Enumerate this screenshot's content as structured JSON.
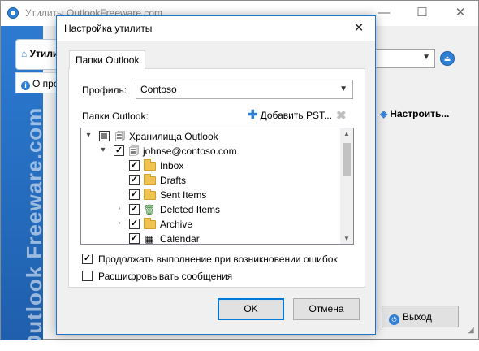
{
  "main_window": {
    "title": "Утилиты OutlookFreeware.com",
    "side_brand": "Outlook Freeware.com",
    "tabs": [
      {
        "label": "Утилиты"
      },
      {
        "label": "О программе"
      }
    ],
    "configure_label": "Настроить...",
    "exit_label": "Выход",
    "controls": {
      "minimize": "—",
      "maximize": "☐",
      "close": "✕"
    }
  },
  "dialog": {
    "title": "Настройка утилиты",
    "close_glyph": "✕",
    "tab_label": "Папки Outlook",
    "profile_label": "Профиль:",
    "profile_value": "Contoso",
    "folders_label": "Папки Outlook:",
    "add_pst_label": "Добавить PST...",
    "tree": [
      {
        "label": "Хранилища Outlook",
        "icon": "stores-icon",
        "check": "partial",
        "expander": "expanded",
        "level": 0
      },
      {
        "label": "johnse@contoso.com",
        "icon": "mailbox-icon",
        "check": "checked",
        "expander": "expanded",
        "level": 1
      },
      {
        "label": "Inbox",
        "icon": "inbox-folder-icon",
        "check": "checked",
        "expander": "",
        "level": 2
      },
      {
        "label": "Drafts",
        "icon": "drafts-folder-icon",
        "check": "checked",
        "expander": "",
        "level": 2
      },
      {
        "label": "Sent Items",
        "icon": "sent-folder-icon",
        "check": "checked",
        "expander": "",
        "level": 2
      },
      {
        "label": "Deleted Items",
        "icon": "trash-folder-icon",
        "check": "checked",
        "expander": "collapsed",
        "level": 2
      },
      {
        "label": "Archive",
        "icon": "archive-folder-icon",
        "check": "checked",
        "expander": "collapsed",
        "level": 2
      },
      {
        "label": "Calendar",
        "icon": "calendar-icon",
        "check": "checked",
        "expander": "",
        "level": 2
      }
    ],
    "options": [
      {
        "label": "Продолжать выполнение при возникновении ошибок",
        "checked": true
      },
      {
        "label": "Расшифровывать сообщения",
        "checked": false
      }
    ],
    "ok_label": "OK",
    "cancel_label": "Отмена"
  }
}
